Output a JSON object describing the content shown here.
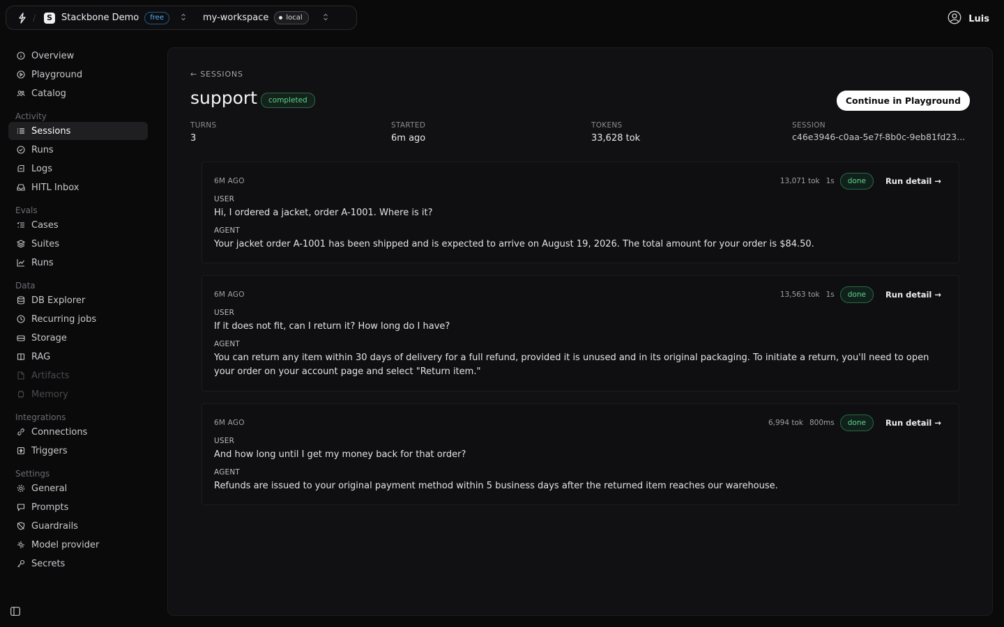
{
  "topbar": {
    "org_name": "Stackbone Demo",
    "org_initial": "S",
    "plan_badge": "free",
    "workspace_name": "my-workspace",
    "env_badge": "local"
  },
  "user": {
    "name": "Luis"
  },
  "sidebar": {
    "top_items": [
      {
        "label": "Overview",
        "icon": "info-icon"
      },
      {
        "label": "Playground",
        "icon": "play-circle-icon"
      },
      {
        "label": "Catalog",
        "icon": "users-icon"
      }
    ],
    "sections": [
      {
        "title": "Activity",
        "items": [
          {
            "label": "Sessions",
            "icon": "list-icon",
            "active": true
          },
          {
            "label": "Runs",
            "icon": "check-circle-icon"
          },
          {
            "label": "Logs",
            "icon": "log-icon"
          },
          {
            "label": "HITL Inbox",
            "icon": "inbox-icon"
          }
        ]
      },
      {
        "title": "Evals",
        "items": [
          {
            "label": "Cases",
            "icon": "checklist-icon"
          },
          {
            "label": "Suites",
            "icon": "suites-icon"
          },
          {
            "label": "Runs",
            "icon": "chart-icon"
          }
        ]
      },
      {
        "title": "Data",
        "items": [
          {
            "label": "DB Explorer",
            "icon": "database-icon"
          },
          {
            "label": "Recurring jobs",
            "icon": "clock-icon"
          },
          {
            "label": "Storage",
            "icon": "storage-icon"
          },
          {
            "label": "RAG",
            "icon": "book-icon"
          },
          {
            "label": "Artifacts",
            "icon": "file-icon",
            "disabled": true
          },
          {
            "label": "Memory",
            "icon": "memory-icon",
            "disabled": true
          }
        ]
      },
      {
        "title": "Integrations",
        "items": [
          {
            "label": "Connections",
            "icon": "link-icon"
          },
          {
            "label": "Triggers",
            "icon": "trigger-icon"
          }
        ]
      },
      {
        "title": "Settings",
        "items": [
          {
            "label": "General",
            "icon": "gear-icon"
          },
          {
            "label": "Prompts",
            "icon": "chat-icon"
          },
          {
            "label": "Guardrails",
            "icon": "shield-icon"
          },
          {
            "label": "Model provider",
            "icon": "model-icon"
          },
          {
            "label": "Secrets",
            "icon": "key-icon"
          }
        ]
      }
    ]
  },
  "session": {
    "back_label": "← SESSIONS",
    "title": "support",
    "status": "completed",
    "continue_label": "Continue in Playground",
    "stats": [
      {
        "label": "TURNS",
        "value": "3"
      },
      {
        "label": "STARTED",
        "value": "6m ago"
      },
      {
        "label": "TOKENS",
        "value": "33,628 tok"
      },
      {
        "label": "SESSION",
        "value": "c46e3946-c0aa-5e7f-8b0c-9eb81fd23..."
      }
    ],
    "turns": [
      {
        "time": "6M AGO",
        "tokens": "13,071 tok",
        "duration": "1s",
        "status": "done",
        "run_detail": "Run detail →",
        "user_label": "USER",
        "user_msg": "Hi, I ordered a jacket, order A-1001. Where is it?",
        "agent_label": "AGENT",
        "agent_msg": "Your jacket order A-1001 has been shipped and is expected to arrive on August 19, 2026. The total amount for your order is $84.50."
      },
      {
        "time": "6M AGO",
        "tokens": "13,563 tok",
        "duration": "1s",
        "status": "done",
        "run_detail": "Run detail →",
        "user_label": "USER",
        "user_msg": "If it does not fit, can I return it? How long do I have?",
        "agent_label": "AGENT",
        "agent_msg": "You can return any item within 30 days of delivery for a full refund, provided it is unused and in its original packaging. To initiate a return, you'll need to open your order on your account page and select \"Return item.\""
      },
      {
        "time": "6M AGO",
        "tokens": "6,994 tok",
        "duration": "800ms",
        "status": "done",
        "run_detail": "Run detail →",
        "user_label": "USER",
        "user_msg": "And how long until I get my money back for that order?",
        "agent_label": "AGENT",
        "agent_msg": "Refunds are issued to your original payment method within 5 business days after the returned item reaches our warehouse."
      }
    ]
  }
}
